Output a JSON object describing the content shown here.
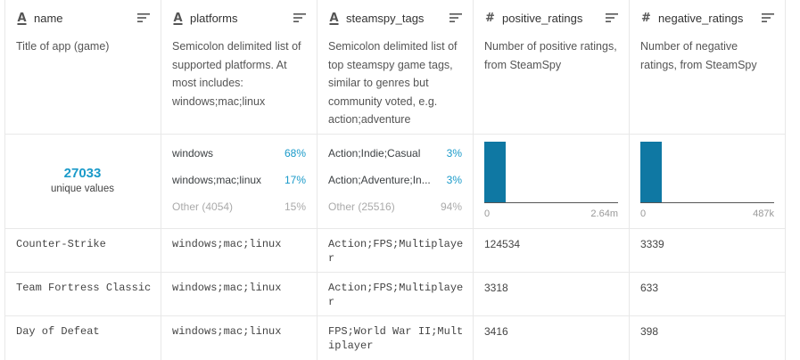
{
  "columns": [
    {
      "key": "name",
      "type_icon": "A",
      "icon_name": "string-type-icon",
      "description": "Title of app (game)",
      "unique_count": "27033",
      "unique_label": "unique values"
    },
    {
      "key": "platforms",
      "type_icon": "A",
      "icon_name": "string-type-icon",
      "description": "Semicolon delimited list of supported platforms. At most includes: windows;mac;linux",
      "top_values": [
        {
          "label": "windows",
          "percent": "68%"
        },
        {
          "label": "windows;mac;linux",
          "percent": "17%"
        }
      ],
      "other": {
        "label": "Other (4054)",
        "percent": "15%"
      }
    },
    {
      "key": "steamspy_tags",
      "type_icon": "A",
      "icon_name": "string-type-icon",
      "description": "Semicolon delimited list of top steamspy game tags, similar to genres but community voted, e.g. action;adventure",
      "top_values": [
        {
          "label": "Action;Indie;Casual",
          "percent": "3%"
        },
        {
          "label": "Action;Adventure;In...",
          "percent": "3%"
        }
      ],
      "other": {
        "label": "Other (25516)",
        "percent": "94%"
      }
    },
    {
      "key": "positive_ratings",
      "type_icon": "#",
      "icon_name": "numeric-type-icon",
      "description": "Number of positive ratings, from SteamSpy",
      "histogram": {
        "min": "0",
        "max": "2.64m",
        "bins": [
          1,
          0,
          0,
          0,
          0,
          0,
          0,
          0,
          0,
          0
        ]
      }
    },
    {
      "key": "negative_ratings",
      "type_icon": "#",
      "icon_name": "numeric-type-icon",
      "description": "Number of negative ratings, from SteamSpy",
      "histogram": {
        "min": "0",
        "max": "487k",
        "bins": [
          1,
          0,
          0,
          0,
          0,
          0,
          0,
          0,
          0,
          0
        ]
      }
    }
  ],
  "rows": [
    [
      "Counter-Strike",
      "windows;mac;linux",
      "Action;FPS;Multiplayer",
      "124534",
      "3339"
    ],
    [
      "Team Fortress Classic",
      "windows;mac;linux",
      "Action;FPS;Multiplayer",
      "3318",
      "633"
    ],
    [
      "Day of Defeat",
      "windows;mac;linux",
      "FPS;World War II;Multiplayer",
      "3416",
      "398"
    ]
  ],
  "colors": {
    "accent": "#1a9ac9",
    "bar": "#0f78a3",
    "border": "#e8e8e8",
    "muted": "#aaaaaa"
  }
}
